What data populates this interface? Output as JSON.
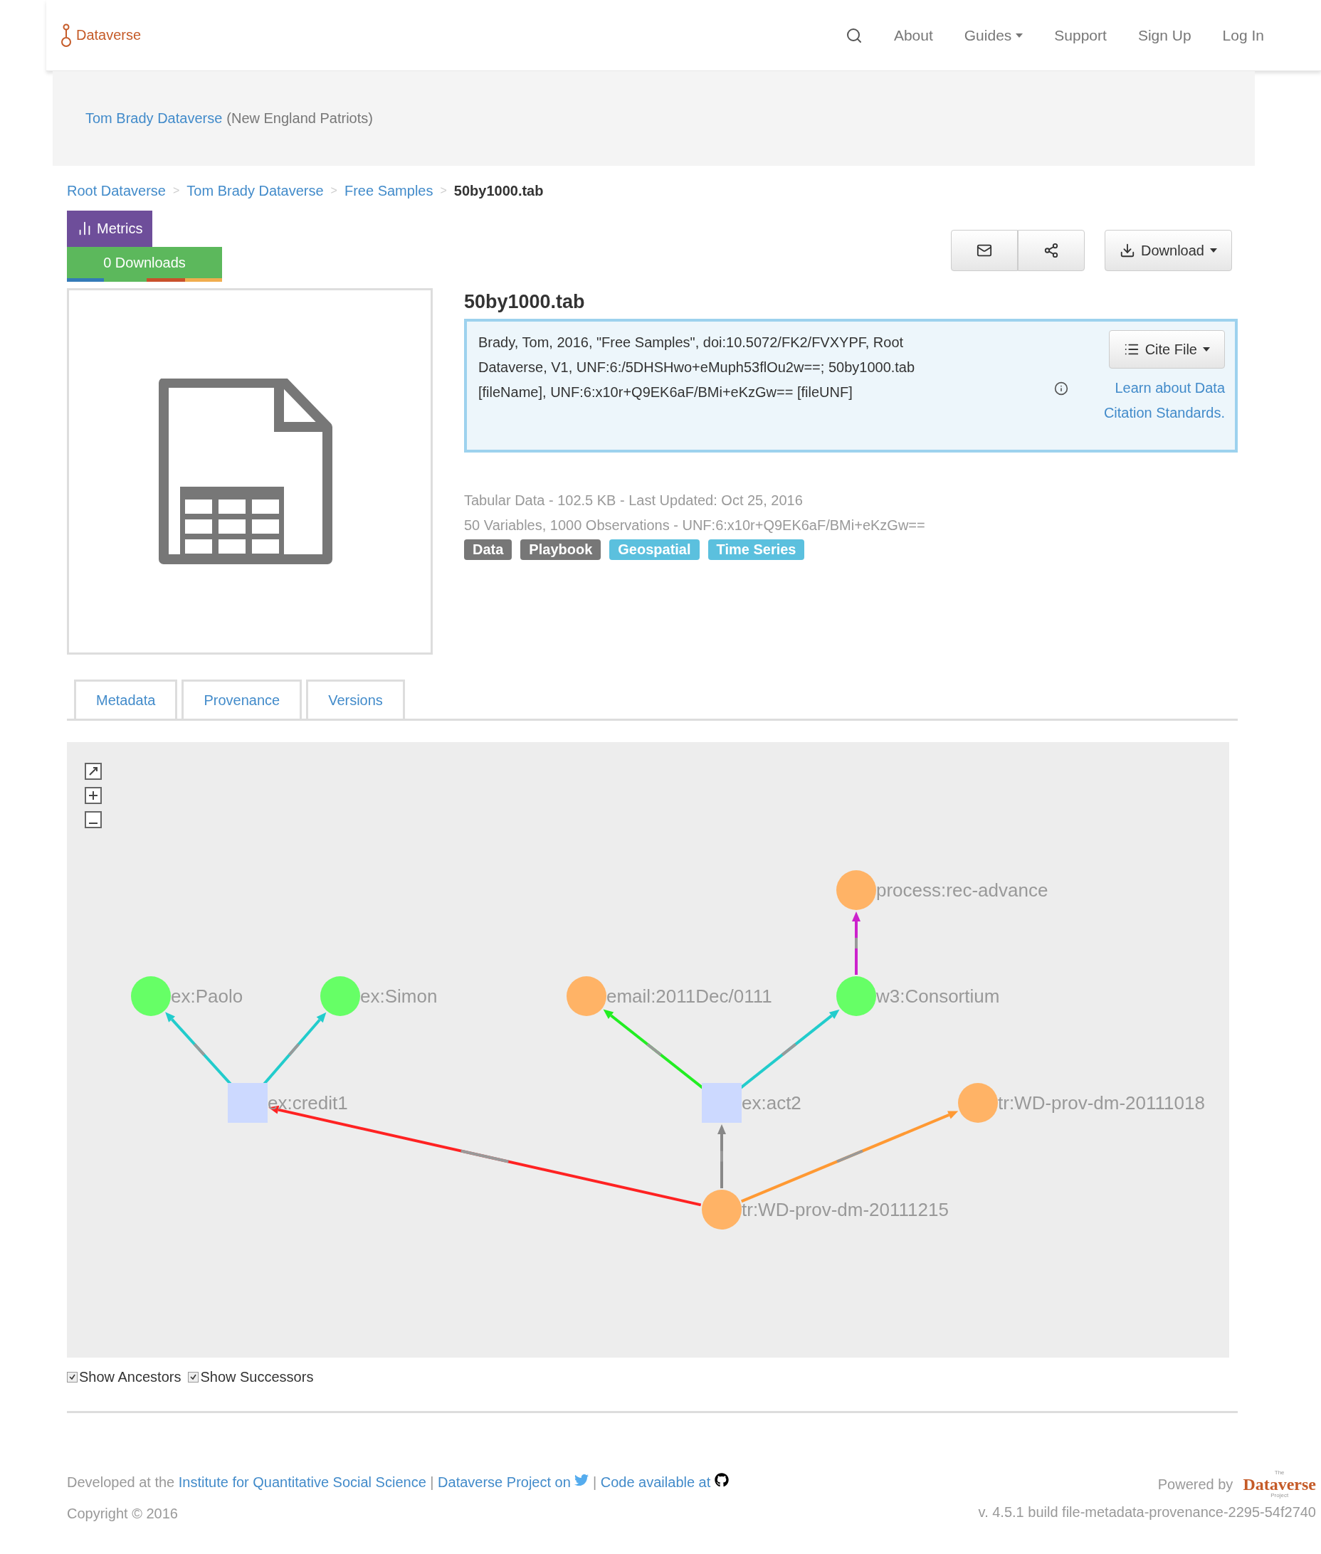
{
  "navbar": {
    "brand": "Dataverse",
    "links": [
      {
        "label": "About",
        "dropdown": false
      },
      {
        "label": "Guides",
        "dropdown": true
      },
      {
        "label": "Support",
        "dropdown": false
      },
      {
        "label": "Sign Up",
        "dropdown": false
      },
      {
        "label": "Log In",
        "dropdown": false
      }
    ]
  },
  "dataverse_header": {
    "name": "Tom Brady Dataverse",
    "affiliation": "(New England Patriots)"
  },
  "breadcrumb": [
    {
      "label": "Root Dataverse",
      "current": false,
      "separator": ">"
    },
    {
      "label": "Tom Brady Dataverse",
      "current": false,
      "separator": ">"
    },
    {
      "label": "Free Samples",
      "current": false,
      "separator": ">"
    },
    {
      "label": "50by1000.tab",
      "current": true
    }
  ],
  "metrics": {
    "title": "Metrics",
    "downloads": "0 Downloads"
  },
  "download_button": "Download",
  "file": {
    "title": "50by1000.tab",
    "citation": "Brady, Tom, 2016, \"Free Samples\", doi:10.5072/FK2/FVXYPF, Root Dataverse, V1, UNF:6:/5DHSHwo+eMuph53flOu2w==; 50by1000.tab [fileName], UNF:6:x10r+Q9EK6aF/BMi+eKzGw== [fileUNF]",
    "cite_button": "Cite File",
    "learn_link": "Learn about Data Citation Standards.",
    "info_lines": [
      "Tabular Data - 102.5 KB - Last Updated: Oct 25, 2016",
      "50 Variables, 1000 Observations - UNF:6:x10r+Q9EK6aF/BMi+eKzGw=="
    ],
    "tags": [
      {
        "label": "Data",
        "color": "#777777"
      },
      {
        "label": "Playbook",
        "color": "#777777"
      },
      {
        "label": "Geospatial",
        "color": "#5bc0de"
      },
      {
        "label": "Time Series",
        "color": "#5bc0de"
      }
    ]
  },
  "tabs": [
    {
      "label": "Metadata"
    },
    {
      "label": "Provenance"
    },
    {
      "label": "Versions"
    }
  ],
  "graph": {
    "nodes": [
      {
        "label": "ex:Paolo",
        "kind": "agent"
      },
      {
        "label": "ex:Simon",
        "kind": "agent"
      },
      {
        "label": "ex:credit1",
        "kind": "activity"
      },
      {
        "label": "email:2011Dec/0111",
        "kind": "entity"
      },
      {
        "label": "w3:Consortium",
        "kind": "agent"
      },
      {
        "label": "process:rec-advance",
        "kind": "entity"
      },
      {
        "label": "ex:act2",
        "kind": "activity"
      },
      {
        "label": "tr:WD-prov-dm-20111018",
        "kind": "entity"
      },
      {
        "label": "tr:WD-prov-dm-20111215",
        "kind": "entity"
      }
    ],
    "edges": [
      {
        "color": "#22cccc"
      },
      {
        "color": "#22cccc"
      },
      {
        "color": "#22ee22"
      },
      {
        "color": "#22cccc"
      },
      {
        "color": "#cc22cc"
      },
      {
        "color": "#888888"
      },
      {
        "color": "#ff2222"
      },
      {
        "color": "#ff9933"
      }
    ]
  },
  "options": [
    {
      "label": "Show Ancestors",
      "checked": true
    },
    {
      "label": "Show Successors",
      "checked": true
    }
  ],
  "footer": {
    "developed_prefix": "Developed at the",
    "institute_link": "Institute for Quantitative Social Science",
    "separator_1": "|",
    "project_link": "Dataverse Project on",
    "separator_2": "|",
    "code_link": "Code available at",
    "copyright": "Copyright © 2016",
    "powered_by": "Powered by",
    "logo_small": "The",
    "logo_name": "Dataverse",
    "logo_project": "Project",
    "version": "v. 4.5.1 build file-metadata-provenance-2295-54f2740"
  }
}
